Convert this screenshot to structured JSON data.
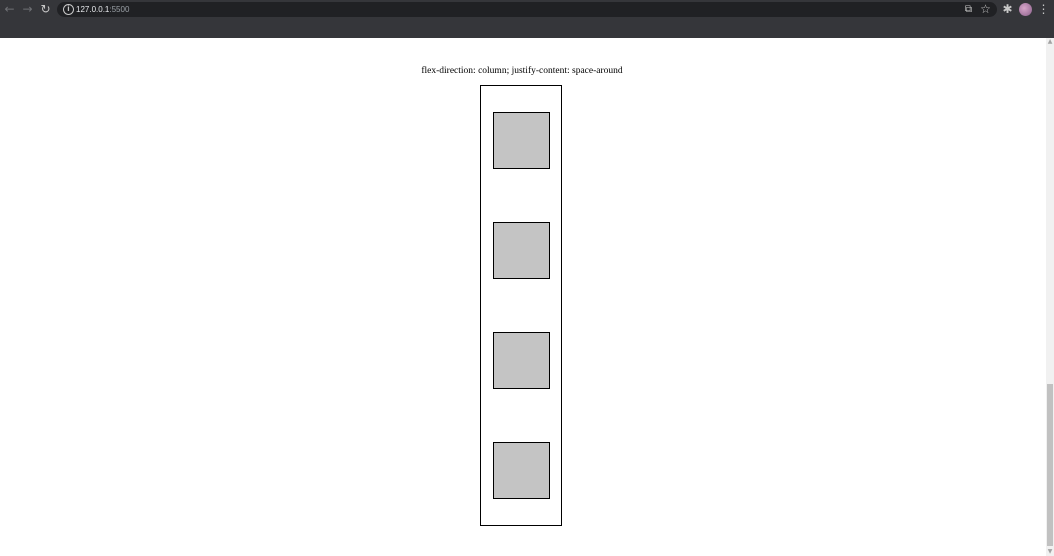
{
  "browser": {
    "url_host": "127.0.0.1",
    "url_port": ":5500",
    "icons": {
      "back": "back-arrow-icon",
      "forward": "forward-arrow-icon",
      "reload": "reload-icon",
      "site_info": "info-icon",
      "translate": "translate-icon",
      "bookmark": "star-icon",
      "extensions": "puzzle-icon",
      "menu": "kebab-menu-icon"
    },
    "glyphs": {
      "back": "←",
      "forward": "→",
      "reload": "↻",
      "info": "i",
      "translate": "⧉",
      "star": "☆",
      "extensions": "✱",
      "menu": "⋮",
      "scroll_up": "▲",
      "scroll_down": "▼"
    }
  },
  "page": {
    "caption": "flex-direction: column; justify-content: space-around",
    "boxes": [
      {
        "id": 1
      },
      {
        "id": 2
      },
      {
        "id": 3
      },
      {
        "id": 4
      }
    ]
  },
  "colors": {
    "chrome_bg": "#35363a",
    "box_fill": "#c4c4c4",
    "border": "#000000"
  }
}
